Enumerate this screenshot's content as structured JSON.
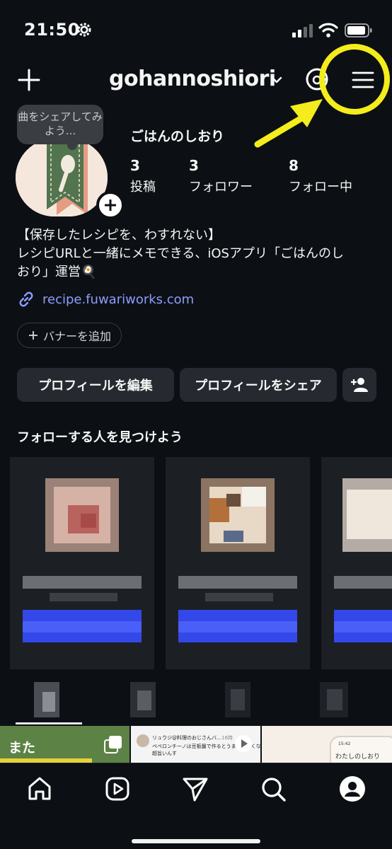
{
  "status_bar": {
    "time": "21:50"
  },
  "header": {
    "username": "gohannoshiori"
  },
  "profile": {
    "note": "曲をシェアしてみよう...",
    "display_name": "ごはんのしおり",
    "stats": [
      {
        "value": "3",
        "label": "投稿"
      },
      {
        "value": "3",
        "label": "フォロワー"
      },
      {
        "value": "8",
        "label": "フォロー中"
      }
    ],
    "bio_line1": "【保存したレシピを、わすれない】",
    "bio_line2": "レシピURLと一緒にメモできる、iOSアプリ「ごはんのし",
    "bio_line3": "おり」運営🍳",
    "link": "recipe.fuwariworks.com"
  },
  "buttons": {
    "add_banner": "バナーを追加",
    "edit_profile": "プロフィールを編集",
    "share_profile": "プロフィールをシェア"
  },
  "suggestions": {
    "title": "フォローする人を見つけよう"
  },
  "grid": {
    "post1_text": "また",
    "post2_author": "リュウジ@料理のおじさんバ...",
    "post2_time": "16時",
    "post2_body1": "ペペロンチーノは豆板醤で作るとうま味が深くなって",
    "post2_body2": "超旨いんす",
    "post3_time": "15:42",
    "post3_title": "わたしのしおり"
  },
  "colors": {
    "annotation": "#f4ec1c",
    "link": "#8e9cff",
    "button_bg": "#262a30",
    "suggest_blue": "#3348e8"
  }
}
